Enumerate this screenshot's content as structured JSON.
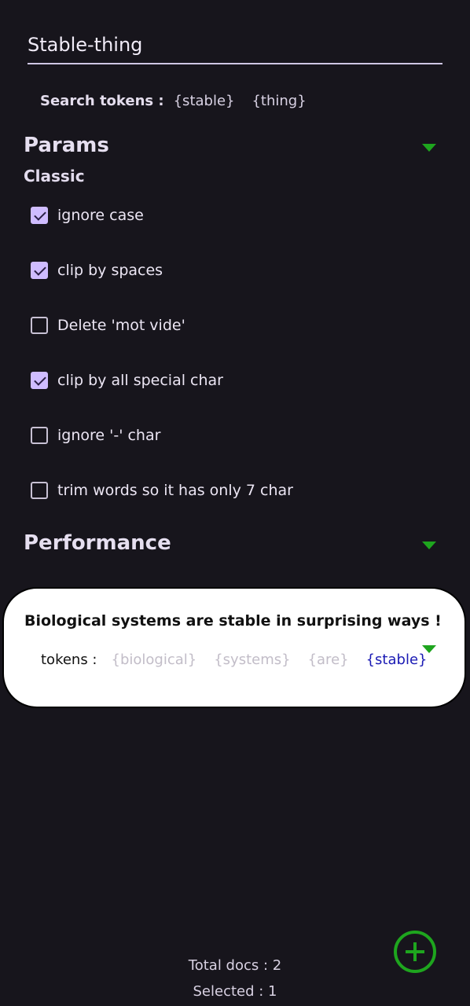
{
  "search": {
    "value": "Stable-thing"
  },
  "search_tokens": {
    "label": "Search tokens :",
    "tokens": [
      "{stable}",
      "{thing}"
    ]
  },
  "params": {
    "title": "Params",
    "subtitle": "Classic",
    "options": [
      {
        "label": "ignore case",
        "checked": true
      },
      {
        "label": "clip by spaces",
        "checked": true
      },
      {
        "label": "Delete 'mot vide'",
        "checked": false
      },
      {
        "label": "clip by all special char",
        "checked": true
      },
      {
        "label": "ignore '-' char",
        "checked": false
      },
      {
        "label": "trim words so it has only 7 char",
        "checked": false
      }
    ]
  },
  "performance": {
    "title": "Performance"
  },
  "document": {
    "title": "Biological systems are stable in surprising ways !",
    "tokens_label": "tokens :",
    "tokens": [
      "{biological}",
      "{systems}",
      "{are}",
      "{stable}"
    ],
    "matched_token": "{stable}"
  },
  "footer": {
    "total_docs": "Total docs : 2",
    "selected": "Selected : 1"
  },
  "colors": {
    "accent": "#1ea51e",
    "checkbox": "#cfbcff",
    "match": "#1a1ab4"
  }
}
